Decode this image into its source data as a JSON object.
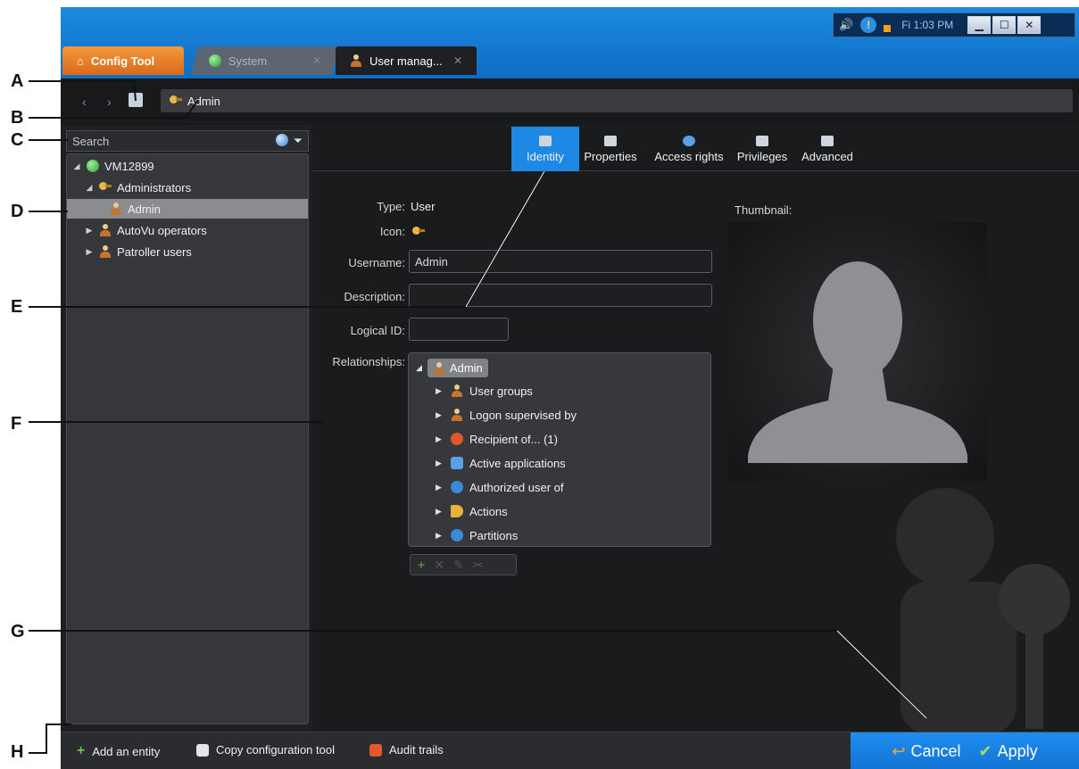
{
  "callouts": [
    "A",
    "B",
    "C",
    "D",
    "E",
    "F",
    "G",
    "H"
  ],
  "tray": {
    "clock": "Fi 1:03 PM",
    "icons": [
      "speaker-icon",
      "warning-icon"
    ]
  },
  "window_buttons": [
    "▁",
    "☐",
    "✕"
  ],
  "tabs": [
    {
      "label": "Config Tool",
      "icon": "home-icon"
    },
    {
      "label": "System",
      "icon": "globe-icon"
    },
    {
      "label": "User manag...",
      "icon": "user-icon"
    }
  ],
  "nav": {
    "back": "‹",
    "forward": "›",
    "breadcrumb": "Admin"
  },
  "search": {
    "placeholder": "Search"
  },
  "tree": {
    "root": "VM12899",
    "items": [
      {
        "label": "Administrators"
      },
      {
        "label": "Admin"
      },
      {
        "label": "AutoVu operators"
      },
      {
        "label": "Patroller users"
      }
    ]
  },
  "property_tabs": [
    "Identity",
    "Properties",
    "Access rights",
    "Privileges",
    "Advanced"
  ],
  "identity": {
    "type_label": "Type:",
    "type_value": "User",
    "icon_label": "Icon:",
    "username_label": "Username:",
    "username_value": "Admin",
    "description_label": "Description:",
    "description_value": "",
    "logical_id_label": "Logical ID:",
    "logical_id_value": "",
    "relationships_label": "Relationships:",
    "thumbnail_label": "Thumbnail:"
  },
  "relationships": {
    "root": "Admin",
    "items": [
      {
        "label": "User groups",
        "icon": "user-group-icon",
        "color": "#d97a2a"
      },
      {
        "label": "Logon supervised by",
        "icon": "user-icon",
        "color": "#d97a2a"
      },
      {
        "label": "Recipient of... (1)",
        "icon": "alarm-icon",
        "color": "#e0582a"
      },
      {
        "label": "Active applications",
        "icon": "application-icon",
        "color": "#5aa0e8"
      },
      {
        "label": "Authorized user of",
        "icon": "globe-icon",
        "color": "#3b8ad9"
      },
      {
        "label": "Actions",
        "icon": "megaphone-icon",
        "color": "#e8b23a"
      },
      {
        "label": "Partitions",
        "icon": "partition-icon",
        "color": "#3b8ad9"
      }
    ]
  },
  "reltools": [
    "+",
    "✕",
    "✎",
    "✂"
  ],
  "bottom": {
    "add": "Add an entity",
    "copy": "Copy configuration tool",
    "audit": "Audit trails",
    "cancel": "Cancel",
    "apply": "Apply"
  },
  "colors": {
    "accent": "#1e88e5",
    "config_tab": "#e8822a",
    "titlebar": "#1482d9"
  }
}
